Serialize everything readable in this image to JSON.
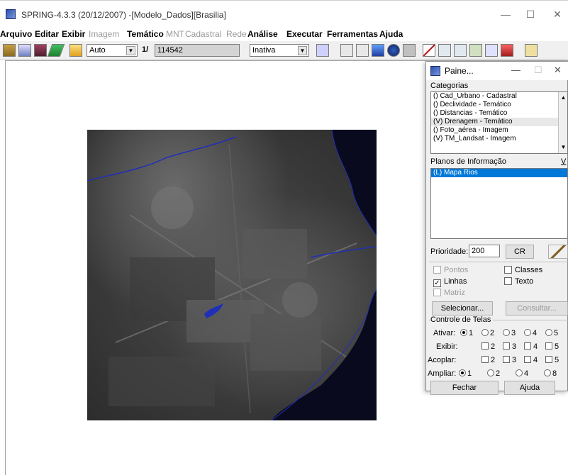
{
  "window": {
    "title": "SPRING-4.3.3 (20/12/2007) -[Modelo_Dados][Brasilia]",
    "controls": {
      "minimize": "—",
      "maximize": "☐",
      "close": "✕"
    }
  },
  "menu": [
    {
      "label": "Arquivo",
      "bold": true,
      "disabled": false
    },
    {
      "label": "Editar",
      "bold": true,
      "disabled": false
    },
    {
      "label": "Exibir",
      "bold": true,
      "disabled": false
    },
    {
      "label": "Imagem",
      "bold": false,
      "disabled": true
    },
    {
      "label": "Temático",
      "bold": true,
      "disabled": false
    },
    {
      "label": "MNT",
      "bold": false,
      "disabled": true
    },
    {
      "label": "Cadastral",
      "bold": false,
      "disabled": true
    },
    {
      "label": "Rede",
      "bold": false,
      "disabled": true
    },
    {
      "label": "Análise",
      "bold": true,
      "disabled": false
    },
    {
      "label": "Executar",
      "bold": true,
      "disabled": false
    },
    {
      "label": "Ferramentas",
      "bold": true,
      "disabled": false
    },
    {
      "label": "Ajuda",
      "bold": true,
      "disabled": false
    }
  ],
  "toolbar": {
    "scale_mode": "Auto",
    "scale_prefix": "1/",
    "scale_value": "114542",
    "cursor_mode": "Inativa"
  },
  "panel": {
    "title": "Paine...",
    "categories_label": "Categorias",
    "categories": [
      {
        "label": "() Cad_Urbano - Cadastral",
        "state": "normal"
      },
      {
        "label": "() Declividade - Temático",
        "state": "normal"
      },
      {
        "label": "() Distancias - Temático",
        "state": "normal"
      },
      {
        "label": "(V) Drenagem - Temático",
        "state": "highlight"
      },
      {
        "label": "() Foto_aérea - Imagem",
        "state": "normal"
      },
      {
        "label": "(V) TM_Landsat - Imagem",
        "state": "normal"
      }
    ],
    "planes_label": "Planos de Informação",
    "planes_v": "V",
    "planes": [
      {
        "label": "(L) Mapa Rios",
        "state": "selected"
      }
    ],
    "priority_label": "Prioridade:",
    "priority_value": "200",
    "cr_button": "CR",
    "checks": {
      "pontos": "Pontos",
      "classes": "Classes",
      "linhas": "Linhas",
      "texto": "Texto",
      "matriz": "Matriz"
    },
    "select_button": "Selecionar...",
    "consult_button": "Consultar...",
    "screens_label": "Controle de Telas",
    "ativar_label": "Ativar:",
    "exibir_label": "Exibir:",
    "acoplar_label": "Acoplar:",
    "ampliar_label": "Ampliar:",
    "nums": {
      "n1": "1",
      "n2": "2",
      "n3": "3",
      "n4": "4",
      "n5": "5",
      "n8": "8"
    },
    "close_button": "Fechar",
    "help_button": "Ajuda"
  },
  "colors": {
    "selection": "#0078d7",
    "water": "#0a0a1e",
    "river_line": "#1f2fb8"
  }
}
